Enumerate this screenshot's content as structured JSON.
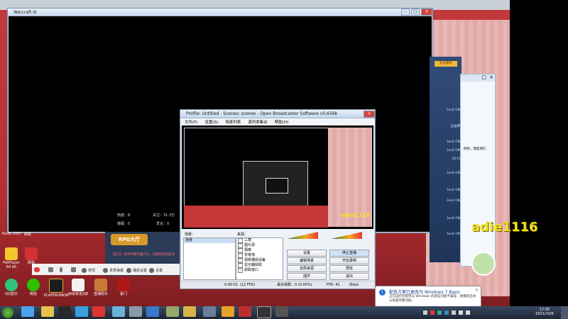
{
  "warcraft": {
    "title": "Warcraft III"
  },
  "stream_stats": {
    "heat_label": "热度：8",
    "follow_label": "关注：31.3万",
    "danmu_label": "弹幕：0",
    "gift_label": "发言：0"
  },
  "obs": {
    "title": "Profile: Untitled - Scenes: scenes - Open Broadcaster Software v0.656b",
    "menu": [
      "文件(F)",
      "设置(S)",
      "场景列表",
      "源列表集合",
      "帮助(H)"
    ],
    "scenes_label": "场景：",
    "scenes": [
      "场景"
    ],
    "sources_label": "来源：",
    "sources": [
      {
        "label": "三角",
        "checked": false
      },
      {
        "label": "图片源",
        "checked": false
      },
      {
        "label": "隔离",
        "checked": false
      },
      {
        "label": "背景墙",
        "checked": false
      },
      {
        "label": "视频捕捉设备",
        "checked": true
      },
      {
        "label": "显示器获取",
        "checked": false
      },
      {
        "label": "获取窗口",
        "checked": true
      }
    ],
    "buttons": {
      "settings": "设置",
      "stop_live": "停止直播",
      "edit_scene": "编辑场景",
      "start_record": "开始录制",
      "global_sources": "全局来源",
      "preview_stream": "预览",
      "plugins": "插件",
      "exit": "退出"
    },
    "status": {
      "time": "0:00:01",
      "fps_label": "(12 FPS)",
      "dropped": "丢失帧数：0 (0.00%)",
      "fps": "FPS: 41",
      "bitrate": "0kb/s"
    }
  },
  "chat_bar": {
    "warning": "【官方】请勿传播不雅行为，违规将受到处罚",
    "items": [
      "表情",
      "发表弹幕",
      "播放设置",
      "设置"
    ],
    "rpg_label": "RPG大厅"
  },
  "right_panel": {
    "dialog_title": "adie1116",
    "overlay_name": "adie1116",
    "preview_name": "adie1116",
    "tag": "会员聊天",
    "lines": [
      "3vs4 ON",
      "自由赛",
      "3vs4 ON",
      "3vs4 ON",
      "3074",
      "3vs4 ON",
      "3vs4 ON",
      "3vs4 ON",
      "3vs4 ON",
      "3vs4 ON"
    ],
    "chat_text": "你好，我是哥们"
  },
  "desktop_icons": [
    {
      "label": "PotPlayer 64 bit"
    },
    {
      "label": "网易"
    },
    {
      "label": "QQ音乐"
    },
    {
      "label": "微信"
    },
    {
      "label": "PLAYERUNKNOWN'S BATTLEGR..."
    },
    {
      "label": "网易有道词典"
    },
    {
      "label": "直播助手"
    },
    {
      "label": "豪门"
    }
  ],
  "left_labels": [
    "Excel 2007",
    "网易"
  ],
  "notification": {
    "title": "配色方案已更改为 Windows 7 Basic",
    "body": "正在运行的程序与 Windows 的某些功能不兼容，请重新启动以恢复完整功能。"
  },
  "clock": {
    "time": "17:00",
    "date": "2021/10/6"
  },
  "colors": {
    "overlay_text": "#f2e21a",
    "red_room": "#b8262a",
    "taskbar": "#1b2636"
  }
}
